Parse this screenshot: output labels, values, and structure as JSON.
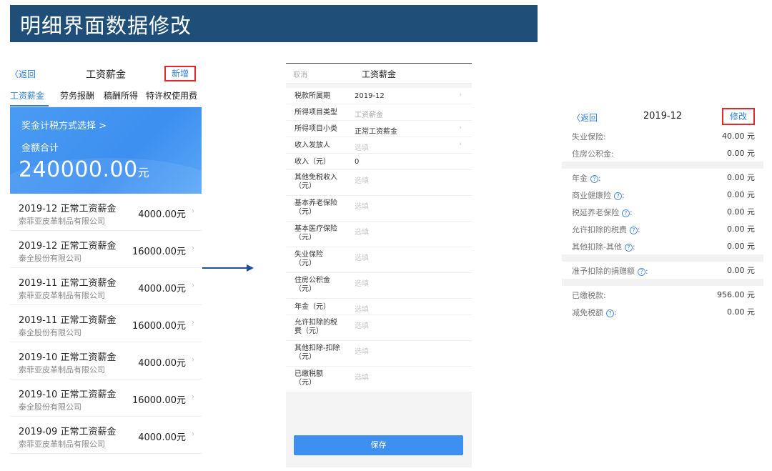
{
  "banner": {
    "title": "明细界面数据修改"
  },
  "panel1": {
    "back": "〈返回",
    "title": "工资薪金",
    "add": "新增",
    "tabs": [
      "工资薪金",
      "劳务报酬",
      "稿酬所得",
      "特许权使用费"
    ],
    "hero": {
      "option": "奖金计税方式选择 >",
      "label": "金额合计",
      "amount": "240000.00",
      "unit": "元"
    },
    "items": [
      {
        "title": "2019-12 正常工资薪金",
        "company": "索菲亚皮革制品有限公司",
        "amount": "4000.00元"
      },
      {
        "title": "2019-12 正常工资薪金",
        "company": "泰全股份有限公司",
        "amount": "16000.00元"
      },
      {
        "title": "2019-11 正常工资薪金",
        "company": "索菲亚皮革制品有限公司",
        "amount": "4000.00元"
      },
      {
        "title": "2019-11 正常工资薪金",
        "company": "泰全股份有限公司",
        "amount": "16000.00元"
      },
      {
        "title": "2019-10 正常工资薪金",
        "company": "索菲亚皮革制品有限公司",
        "amount": "4000.00元"
      },
      {
        "title": "2019-10 正常工资薪金",
        "company": "泰全股份有限公司",
        "amount": "16000.00元"
      },
      {
        "title": "2019-09 正常工资薪金",
        "company": "索菲亚皮革制品有限公司",
        "amount": "4000.00元"
      }
    ]
  },
  "panel2": {
    "cancel": "取消",
    "title": "工资薪金",
    "rows": [
      {
        "label": "税款所属期",
        "value": "2019-12",
        "style": "normal",
        "chevron": true
      },
      {
        "label": "所得项目类型",
        "value": "工资薪金",
        "style": "muted",
        "chevron": false
      },
      {
        "label": "所得项目小类",
        "value": "正常工资薪金",
        "style": "normal",
        "chevron": true
      },
      {
        "label": "收入发放人",
        "value": "选填",
        "style": "hint",
        "chevron": true
      },
      {
        "label": "收入（元）",
        "value": "0",
        "style": "normal",
        "chevron": false
      },
      {
        "label": "其他免税收入\n（元）",
        "value": "选填",
        "style": "hint",
        "chevron": false
      },
      {
        "label": "基本养老保险\n（元）",
        "value": "选填",
        "style": "hint",
        "chevron": false
      },
      {
        "label": "基本医疗保险\n（元）",
        "value": "选填",
        "style": "hint",
        "chevron": false
      },
      {
        "label": "失业保险\n（元）",
        "value": "选填",
        "style": "hint",
        "chevron": false
      },
      {
        "label": "住房公积金\n（元）",
        "value": "选填",
        "style": "hint",
        "chevron": false
      },
      {
        "label": "年金（元）",
        "value": "选填",
        "style": "hint",
        "chevron": false
      },
      {
        "label": "允许扣除的税\n费（元）",
        "value": "选填",
        "style": "hint",
        "chevron": false
      },
      {
        "label": "其他扣除-扣除\n（元）",
        "value": "选填",
        "style": "hint",
        "chevron": false
      },
      {
        "label": "已缴税额\n（元）",
        "value": "选填",
        "style": "hint",
        "chevron": false
      }
    ],
    "save": "保存"
  },
  "panel3": {
    "back": "〈返回",
    "title": "2019-12",
    "edit": "修改",
    "groups": [
      [
        {
          "label": "失业保险:",
          "value": "40.00 元",
          "help": false
        },
        {
          "label": "住房公积金:",
          "value": "0.00 元",
          "help": false
        }
      ],
      [
        {
          "label": "年金",
          "value": "0.00 元",
          "help": true
        },
        {
          "label": "商业健康险",
          "value": "0.00 元",
          "help": true
        },
        {
          "label": "税延养老保险",
          "value": "0.00 元",
          "help": true
        },
        {
          "label": "允许扣除的税费",
          "value": "0.00 元",
          "help": true
        },
        {
          "label": "其他扣除-其他",
          "value": "0.00 元",
          "help": true
        }
      ],
      [
        {
          "label": "准予扣除的捐赠额",
          "value": "0.00 元",
          "help": true
        }
      ],
      [
        {
          "label": "已缴税款:",
          "value": "956.00 元",
          "help": false
        },
        {
          "label": "减免税额",
          "value": "0.00 元",
          "help": true
        }
      ]
    ]
  },
  "colors": {
    "banner": "#1f4e79",
    "accent": "#3d8ff0",
    "highlight": "#e0282d"
  },
  "icons": {
    "arrow": "right-arrow-icon",
    "help": "question-circle-icon",
    "chevron": "chevron-right-icon"
  }
}
